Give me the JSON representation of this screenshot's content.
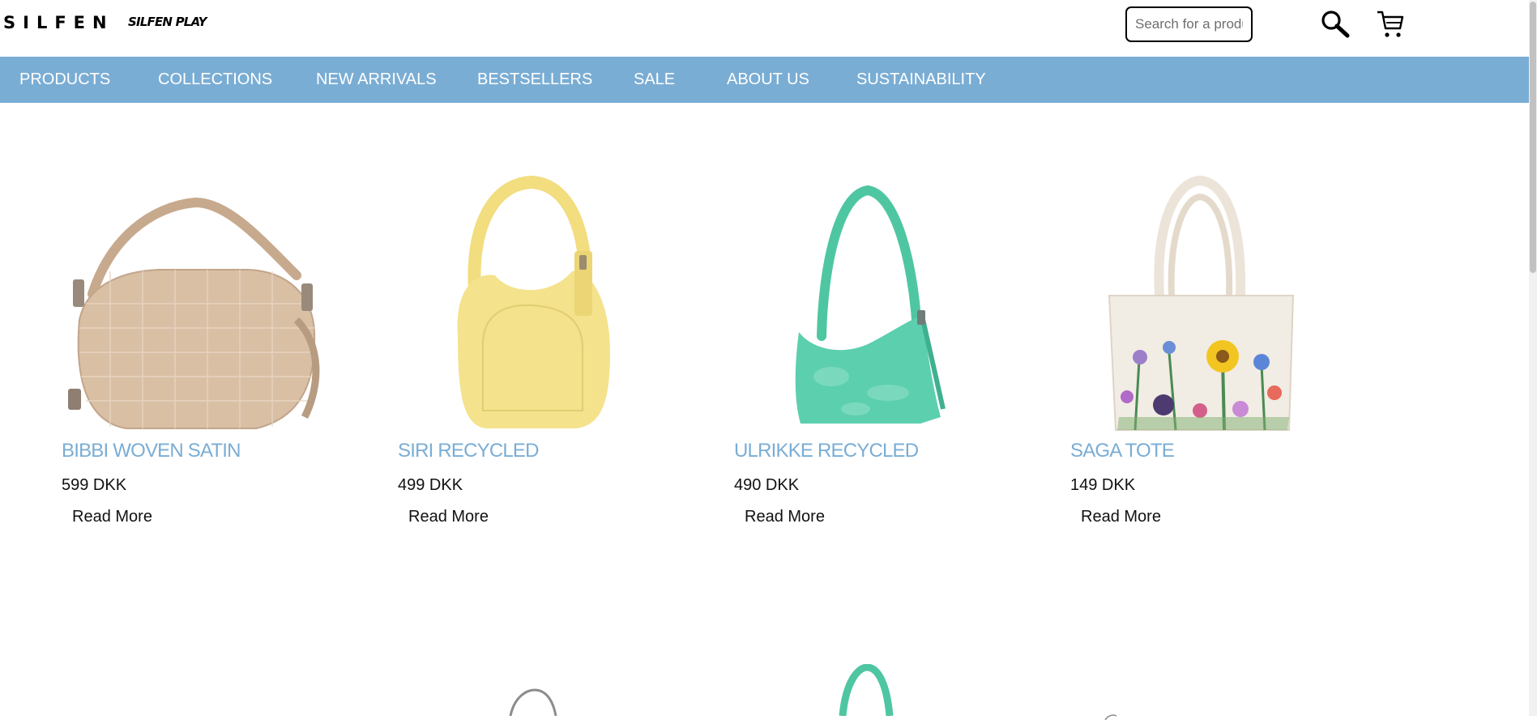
{
  "header": {
    "logo": "SILFEN",
    "logo_secondary": "SILFEN PLAY",
    "search_placeholder": "Search for a product",
    "search_icon": "search-icon",
    "cart_icon": "cart-icon"
  },
  "nav": {
    "items": [
      {
        "label": "PRODUCTS"
      },
      {
        "label": "COLLECTIONS"
      },
      {
        "label": "NEW ARRIVALS"
      },
      {
        "label": "BESTSELLERS"
      },
      {
        "label": "SALE"
      },
      {
        "label": "ABOUT US"
      },
      {
        "label": "SUSTAINABILITY"
      }
    ]
  },
  "products": [
    {
      "name": "BIBBI WOVEN SATIN",
      "price": "599 DKK",
      "cta": "Read More"
    },
    {
      "name": "SIRI RECYCLED",
      "price": "499 DKK",
      "cta": "Read More"
    },
    {
      "name": "ULRIKKE RECYCLED",
      "price": "490 DKK",
      "cta": "Read More"
    },
    {
      "name": "SAGA TOTE",
      "price": "149 DKK",
      "cta": "Read More"
    }
  ],
  "colors": {
    "nav_background": "#7aadd4",
    "product_name": "#7aadd4",
    "bag_beige": "#d9bfa4",
    "bag_yellow": "#f4e28c",
    "bag_green": "#5ccfae",
    "bag_canvas": "#f1ece4"
  }
}
